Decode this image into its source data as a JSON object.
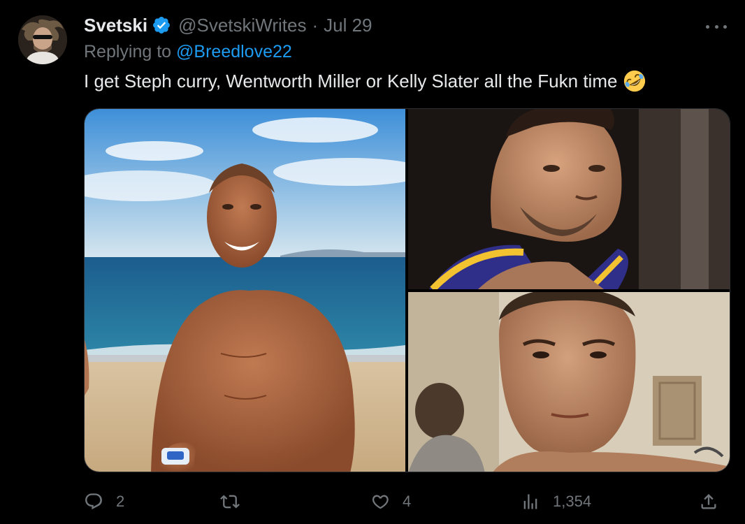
{
  "author": {
    "display_name": "Svetski",
    "handle": "@SvetskiWrites",
    "separator": "·",
    "date": "Jul 29",
    "verified_icon": "verified-badge-icon"
  },
  "reply_context": {
    "prefix": "Replying to",
    "mention": "@Breedlove22"
  },
  "text": "I get Steph curry, Wentworth Miller or Kelly Slater all the Fukn time",
  "text_emoji": "rolling-on-floor-laughing-emoji",
  "media": [
    {
      "name": "shirtless-man-on-beach-photo"
    },
    {
      "name": "basketball-player-closeup-photo"
    },
    {
      "name": "man-closeup-photo"
    }
  ],
  "actions": {
    "reply_count": "2",
    "retweet_count": "",
    "like_count": "4",
    "views_count": "1,354"
  },
  "colors": {
    "background": "#000000",
    "primary_text": "#e7e9ea",
    "secondary_text": "#71767b",
    "link": "#1d9bf0",
    "verified": "#1d9bf0"
  }
}
